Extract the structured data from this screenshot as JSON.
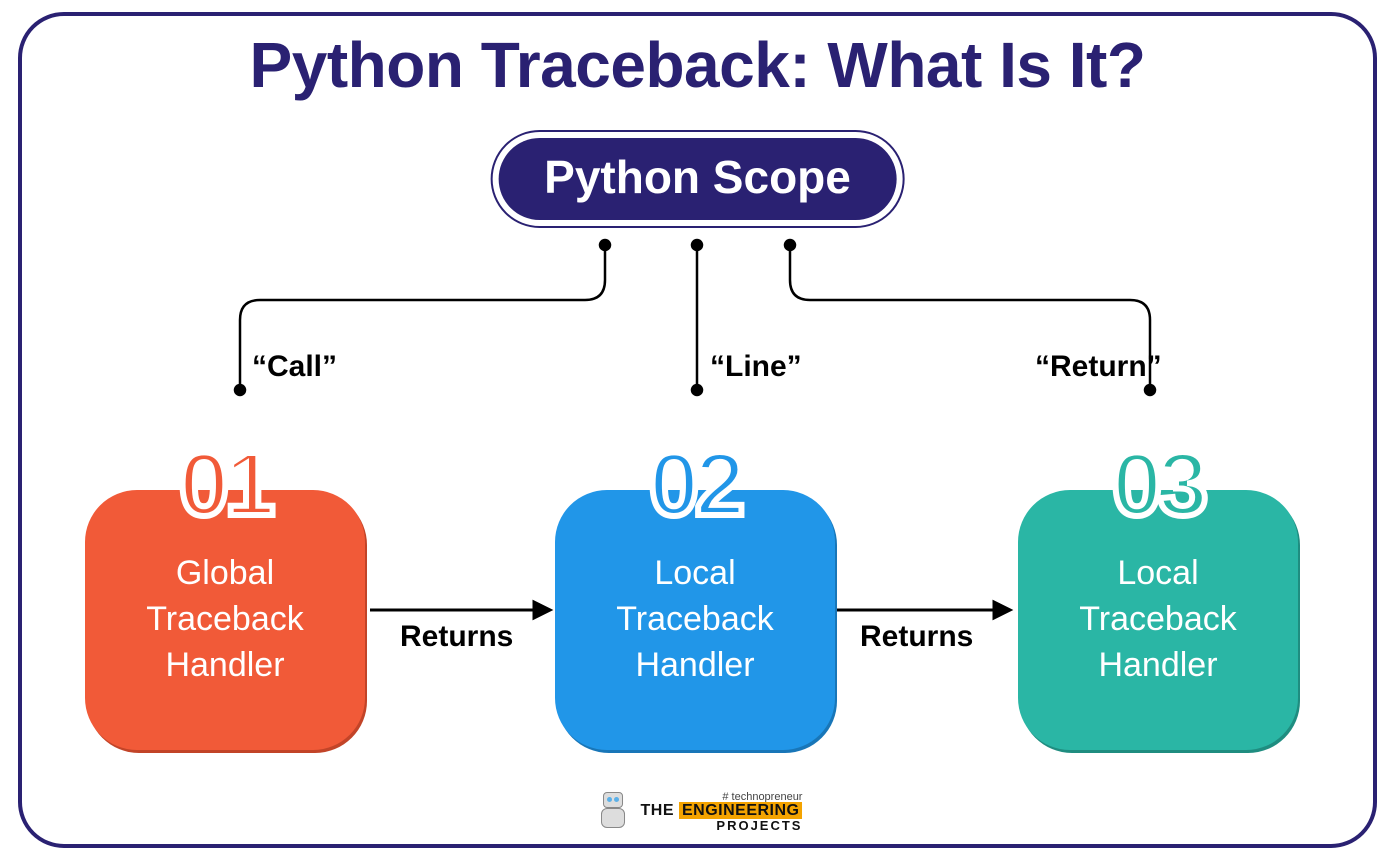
{
  "title": "Python Traceback: What Is It?",
  "central_pill": "Python Scope",
  "branches": [
    {
      "quote": "“Call”",
      "num": "01",
      "label": "Global\nTraceback\nHandler",
      "color": "orange"
    },
    {
      "quote": "“Line”",
      "num": "02",
      "label": "Local\nTraceback\nHandler",
      "color": "blue"
    },
    {
      "quote": "“Return”",
      "num": "03",
      "label": "Local\nTraceback\nHandler",
      "color": "teal"
    }
  ],
  "arrows": [
    {
      "label": "Returns"
    },
    {
      "label": "Returns"
    }
  ],
  "footer": {
    "hashtag": "# technopreneur",
    "brand_pre": "THE ",
    "brand_mid": "ENGINEERING",
    "brand_sub": "PROJECTS"
  }
}
